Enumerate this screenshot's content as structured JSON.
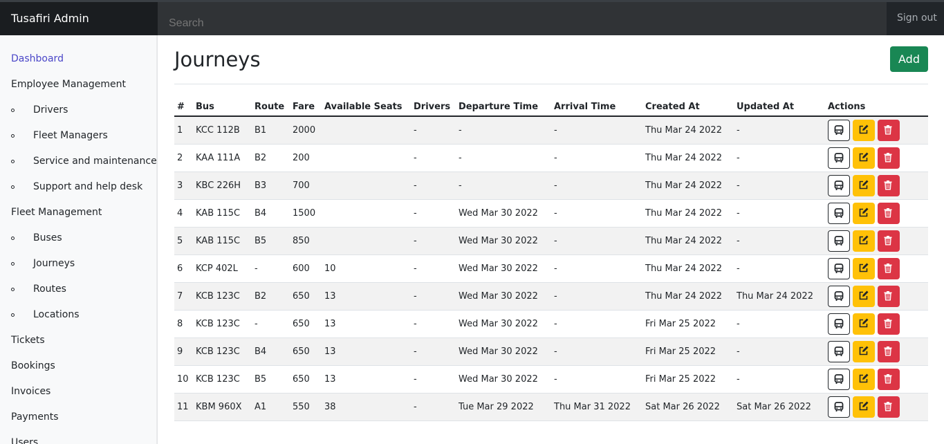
{
  "topbar": {
    "brand": "Tusafiri Admin",
    "search_placeholder": "Search",
    "signout": "Sign out"
  },
  "sidebar": {
    "items": [
      {
        "label": "Dashboard",
        "active": true,
        "sub": false
      },
      {
        "label": "Employee Management",
        "sub": false
      },
      {
        "label": "Drivers",
        "sub": true
      },
      {
        "label": "Fleet Managers",
        "sub": true
      },
      {
        "label": "Service and maintenance",
        "sub": true
      },
      {
        "label": "Support and help desk",
        "sub": true
      },
      {
        "label": "Fleet Management",
        "sub": false
      },
      {
        "label": "Buses",
        "sub": true
      },
      {
        "label": "Journeys",
        "sub": true
      },
      {
        "label": "Routes",
        "sub": true
      },
      {
        "label": "Locations",
        "sub": true
      },
      {
        "label": "Tickets",
        "sub": false
      },
      {
        "label": "Bookings",
        "sub": false
      },
      {
        "label": "Invoices",
        "sub": false
      },
      {
        "label": "Payments",
        "sub": false
      },
      {
        "label": "Users",
        "sub": false
      }
    ]
  },
  "main": {
    "title": "Journeys",
    "add_label": "Add",
    "columns": [
      "#",
      "Bus",
      "Route",
      "Fare",
      "Available Seats",
      "Drivers",
      "Departure Time",
      "Arrival Time",
      "Created At",
      "Updated At",
      "Actions"
    ],
    "rows": [
      [
        "1",
        "KCC 112B",
        "B1",
        "2000",
        "",
        "-",
        "-",
        "-",
        "Thu Mar 24 2022",
        "-"
      ],
      [
        "2",
        "KAA 111A",
        "B2",
        "200",
        "",
        "-",
        "-",
        "-",
        "Thu Mar 24 2022",
        "-"
      ],
      [
        "3",
        "KBC 226H",
        "B3",
        "700",
        "",
        "-",
        "-",
        "-",
        "Thu Mar 24 2022",
        "-"
      ],
      [
        "4",
        "KAB 115C",
        "B4",
        "1500",
        "",
        "-",
        "Wed Mar 30 2022",
        "-",
        "Thu Mar 24 2022",
        "-"
      ],
      [
        "5",
        "KAB 115C",
        "B5",
        "850",
        "",
        "-",
        "Wed Mar 30 2022",
        "-",
        "Thu Mar 24 2022",
        "-"
      ],
      [
        "6",
        "KCP 402L",
        "-",
        "600",
        "10",
        "-",
        "Wed Mar 30 2022",
        "-",
        "Thu Mar 24 2022",
        "-"
      ],
      [
        "7",
        "KCB 123C",
        "B2",
        "650",
        "13",
        "-",
        "Wed Mar 30 2022",
        "-",
        "Thu Mar 24 2022",
        "Thu Mar 24 2022"
      ],
      [
        "8",
        "KCB 123C",
        "-",
        "650",
        "13",
        "-",
        "Wed Mar 30 2022",
        "-",
        "Fri Mar 25 2022",
        "-"
      ],
      [
        "9",
        "KCB 123C",
        "B4",
        "650",
        "13",
        "-",
        "Wed Mar 30 2022",
        "-",
        "Fri Mar 25 2022",
        "-"
      ],
      [
        "10",
        "KCB 123C",
        "B5",
        "650",
        "13",
        "-",
        "Wed Mar 30 2022",
        "-",
        "Fri Mar 25 2022",
        "-"
      ],
      [
        "11",
        "KBM 960X",
        "A1",
        "550",
        "38",
        "-",
        "Tue Mar 29 2022",
        "Thu Mar 31 2022",
        "Sat Mar 26 2022",
        "Sat Mar 26 2022"
      ]
    ],
    "action_icons": [
      "bus-icon",
      "edit-icon",
      "trash-icon"
    ]
  },
  "colors": {
    "accent": "#4a46c8",
    "add": "#198754",
    "edit": "#ffc107",
    "delete": "#dc3545",
    "topbar": "#212529"
  }
}
